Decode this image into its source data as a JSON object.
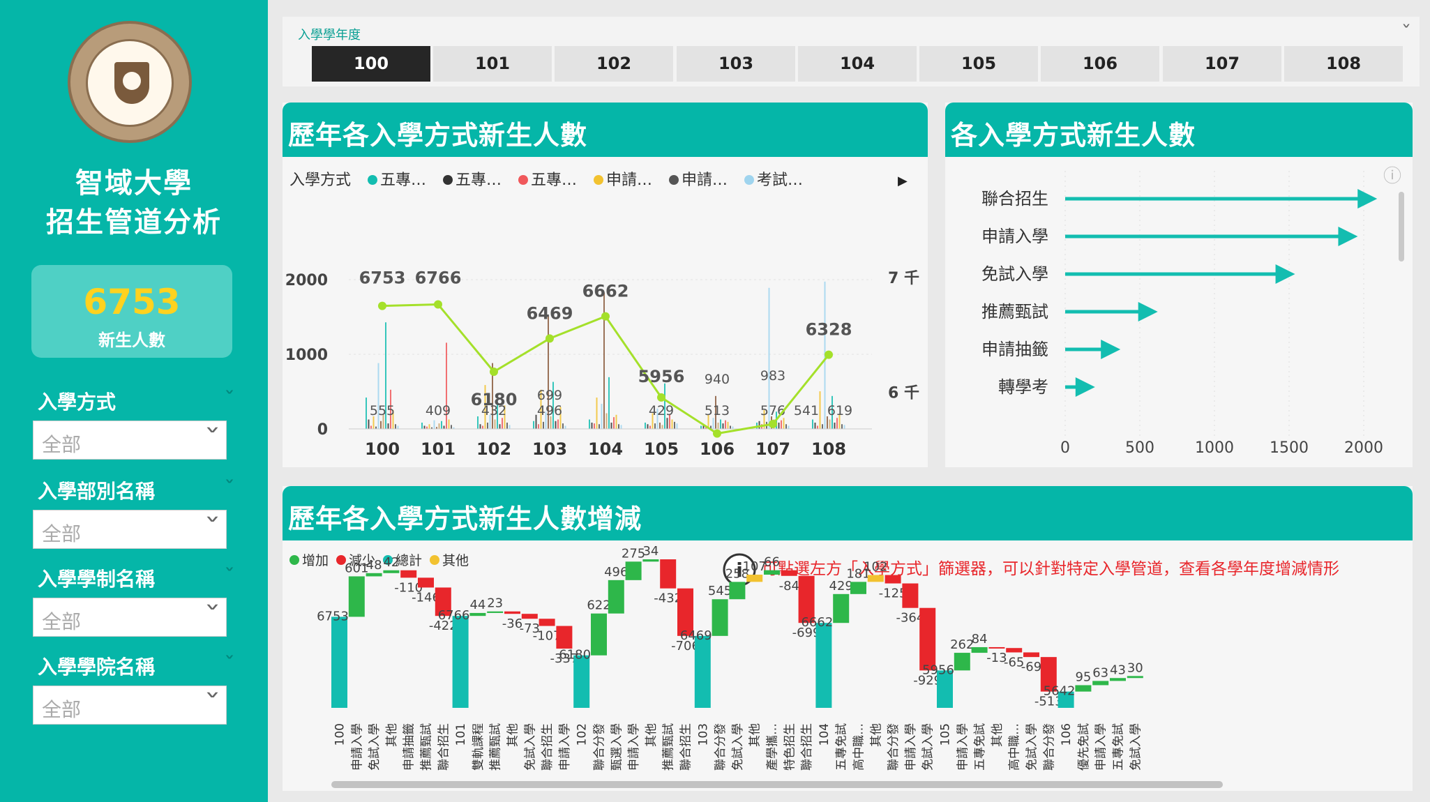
{
  "sidebar": {
    "brand_line1": "智域大學",
    "brand_line2": "招生管道分析",
    "kpi_value": "6753",
    "kpi_label": "新生人數",
    "filters": [
      {
        "title": "入學方式",
        "value": "全部"
      },
      {
        "title": "入學部別名稱",
        "value": "全部"
      },
      {
        "title": "入學學制名稱",
        "value": "全部"
      },
      {
        "title": "入學學院名稱",
        "value": "全部"
      }
    ]
  },
  "slicer": {
    "title": "入學學年度",
    "years": [
      "100",
      "101",
      "102",
      "103",
      "104",
      "105",
      "106",
      "107",
      "108"
    ],
    "selected": "100"
  },
  "colors": {
    "teal": "#05b6a8",
    "kpi": "#ffd21f",
    "increase": "#2eb74a",
    "decrease": "#e8262b",
    "total": "#13bdb0",
    "other": "#f2c230",
    "line": "#a4e02a"
  },
  "card1": {
    "title": "歷年各入學方式新生人數",
    "legend_title": "入學方式",
    "legend": [
      {
        "label": "五專…",
        "color": "#13bdb0"
      },
      {
        "label": "五專…",
        "color": "#333333"
      },
      {
        "label": "五專…",
        "color": "#f0585b"
      },
      {
        "label": "申請…",
        "color": "#f2c230"
      },
      {
        "label": "申請…",
        "color": "#555555"
      },
      {
        "label": "考試…",
        "color": "#9fd4ee"
      }
    ],
    "y_left_ticks": [
      "0",
      "1000",
      "2000"
    ],
    "y_right_ticks": [
      "6 千",
      "7 千"
    ]
  },
  "card2": {
    "title": "各入學方式新生人數",
    "x_ticks": [
      "0",
      "500",
      "1000",
      "1500",
      "2000"
    ]
  },
  "card3": {
    "title": "歷年各入學方式新生人數增減",
    "legend": [
      {
        "label": "增加",
        "color": "#2eb74a"
      },
      {
        "label": "減少",
        "color": "#e8262b"
      },
      {
        "label": "總計",
        "color": "#13bdb0"
      },
      {
        "label": "其他",
        "color": "#f2c230"
      }
    ],
    "note": "可點選左方「入學方式」篩選器，可以針對特定入學管道，查看各學年度增減情形"
  },
  "chart_data": [
    {
      "type": "line",
      "title": "歷年各入學方式新生人數",
      "categories": [
        "100",
        "101",
        "102",
        "103",
        "104",
        "105",
        "106",
        "107",
        "108"
      ],
      "series": [
        {
          "name": "新生人數",
          "values": [
            6753,
            6766,
            6180,
            6469,
            6662,
            5956,
            5642,
            5725,
            6328
          ]
        }
      ],
      "bar_labels": [
        {
          "x": "100",
          "value": 555
        },
        {
          "x": "101",
          "value": 409
        },
        {
          "x": "102",
          "value": 432
        },
        {
          "x": "103",
          "value": 699
        },
        {
          "x": "103",
          "value": 496
        },
        {
          "x": "105",
          "value": 429
        },
        {
          "x": "106",
          "value": 940
        },
        {
          "x": "106",
          "value": 513
        },
        {
          "x": "107",
          "value": 983
        },
        {
          "x": "107",
          "value": 576
        },
        {
          "x": "108",
          "value": 541
        },
        {
          "x": "108",
          "value": 619
        }
      ],
      "y_left_range": [
        0,
        2800
      ],
      "y_right_range": [
        5500,
        7200
      ]
    },
    {
      "type": "bar",
      "title": "各入學方式新生人數",
      "orientation": "horizontal",
      "categories": [
        "聯合招生",
        "申請入學",
        "免試入學",
        "推薦甄試",
        "申請抽籤",
        "轉學考"
      ],
      "values": [
        2090,
        1960,
        1540,
        620,
        370,
        200
      ],
      "xlim": [
        0,
        2100
      ]
    },
    {
      "type": "bar",
      "subtype": "waterfall",
      "title": "歷年各入學方式新生人數增減",
      "items": [
        {
          "label": "100",
          "kind": "total",
          "value": 6753
        },
        {
          "label": "申請入學",
          "kind": "inc",
          "value": 601
        },
        {
          "label": "免試入學",
          "kind": "inc",
          "value": 48
        },
        {
          "label": "其他",
          "kind": "inc",
          "value": 42
        },
        {
          "label": "申請抽籤",
          "kind": "dec",
          "value": -110
        },
        {
          "label": "推薦甄試",
          "kind": "dec",
          "value": -146
        },
        {
          "label": "聯合招生",
          "kind": "dec",
          "value": -422
        },
        {
          "label": "101",
          "kind": "total",
          "value": 6766
        },
        {
          "label": "雙軌課程",
          "kind": "inc",
          "value": 44
        },
        {
          "label": "推薦甄試",
          "kind": "inc",
          "value": 23
        },
        {
          "label": "其他",
          "kind": "dec",
          "value": -36
        },
        {
          "label": "免試入學",
          "kind": "dec",
          "value": -73
        },
        {
          "label": "聯合招生",
          "kind": "dec",
          "value": -107
        },
        {
          "label": "申請入學",
          "kind": "dec",
          "value": -337
        },
        {
          "label": "102",
          "kind": "total",
          "value": 6180
        },
        {
          "label": "聯合分發",
          "kind": "inc",
          "value": 622
        },
        {
          "label": "甄選入學",
          "kind": "inc",
          "value": 496
        },
        {
          "label": "申請入學",
          "kind": "inc",
          "value": 275
        },
        {
          "label": "其他",
          "kind": "inc",
          "value": 34
        },
        {
          "label": "推薦甄試",
          "kind": "dec",
          "value": -432
        },
        {
          "label": "聯合招生",
          "kind": "dec",
          "value": -706
        },
        {
          "label": "103",
          "kind": "total",
          "value": 6469
        },
        {
          "label": "聯合分發",
          "kind": "inc",
          "value": 545
        },
        {
          "label": "免試入學",
          "kind": "inc",
          "value": 258
        },
        {
          "label": "其他",
          "kind": "other",
          "value": 107
        },
        {
          "label": "產學攜…",
          "kind": "inc",
          "value": 66
        },
        {
          "label": "特色招生",
          "kind": "dec",
          "value": -84
        },
        {
          "label": "聯合招生",
          "kind": "dec",
          "value": -699
        },
        {
          "label": "104",
          "kind": "total",
          "value": 6662
        },
        {
          "label": "五專免試",
          "kind": "inc",
          "value": 429
        },
        {
          "label": "高中職…",
          "kind": "inc",
          "value": 181
        },
        {
          "label": "其他",
          "kind": "other",
          "value": 102
        },
        {
          "label": "聯合分發",
          "kind": "dec",
          "value": -125
        },
        {
          "label": "申請入學",
          "kind": "dec",
          "value": -364
        },
        {
          "label": "免試入學",
          "kind": "dec",
          "value": -929
        },
        {
          "label": "105",
          "kind": "total",
          "value": 5956
        },
        {
          "label": "申請入學",
          "kind": "inc",
          "value": 262
        },
        {
          "label": "五專免試",
          "kind": "inc",
          "value": 84
        },
        {
          "label": "其他",
          "kind": "dec",
          "value": -13
        },
        {
          "label": "高中職…",
          "kind": "dec",
          "value": -65
        },
        {
          "label": "免試入學",
          "kind": "dec",
          "value": -69
        },
        {
          "label": "聯合分發",
          "kind": "dec",
          "value": -513
        },
        {
          "label": "106",
          "kind": "total",
          "value": 5642
        },
        {
          "label": "優先免試",
          "kind": "inc",
          "value": 95
        },
        {
          "label": "申請入學",
          "kind": "inc",
          "value": 63
        },
        {
          "label": "五專免試",
          "kind": "inc",
          "value": 43
        },
        {
          "label": "免試入學",
          "kind": "inc",
          "value": 30
        }
      ]
    }
  ]
}
